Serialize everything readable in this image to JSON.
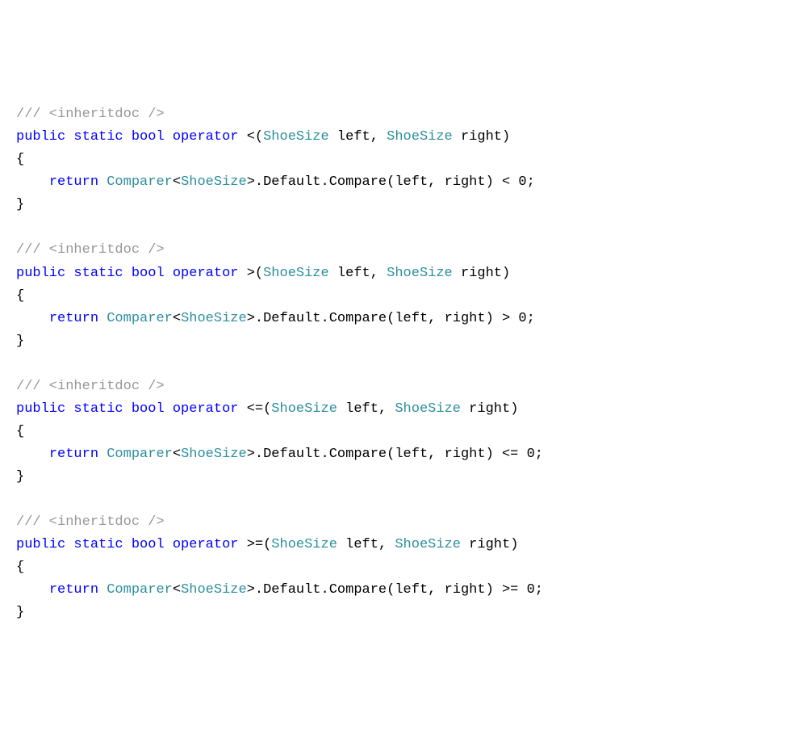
{
  "code": {
    "comment_text": "/// <inheritdoc />",
    "kw_public": "public",
    "kw_static": "static",
    "kw_bool": "bool",
    "kw_operator": "operator",
    "kw_return": "return",
    "type_shoesize": "ShoeSize",
    "id_left": "left",
    "id_right": "right",
    "type_comparer": "Comparer",
    "prop_default": "Default",
    "method_compare": "Compare",
    "num_zero": "0",
    "brace_open": "{",
    "brace_close": "}",
    "paren_open": "(",
    "paren_close": ")",
    "angle_open": "<",
    "angle_close": ">",
    "comma": ",",
    "semi": ";",
    "dot": ".",
    "op_lt": "<",
    "op_gt": ">",
    "op_lte": "<=",
    "op_gte": ">="
  }
}
